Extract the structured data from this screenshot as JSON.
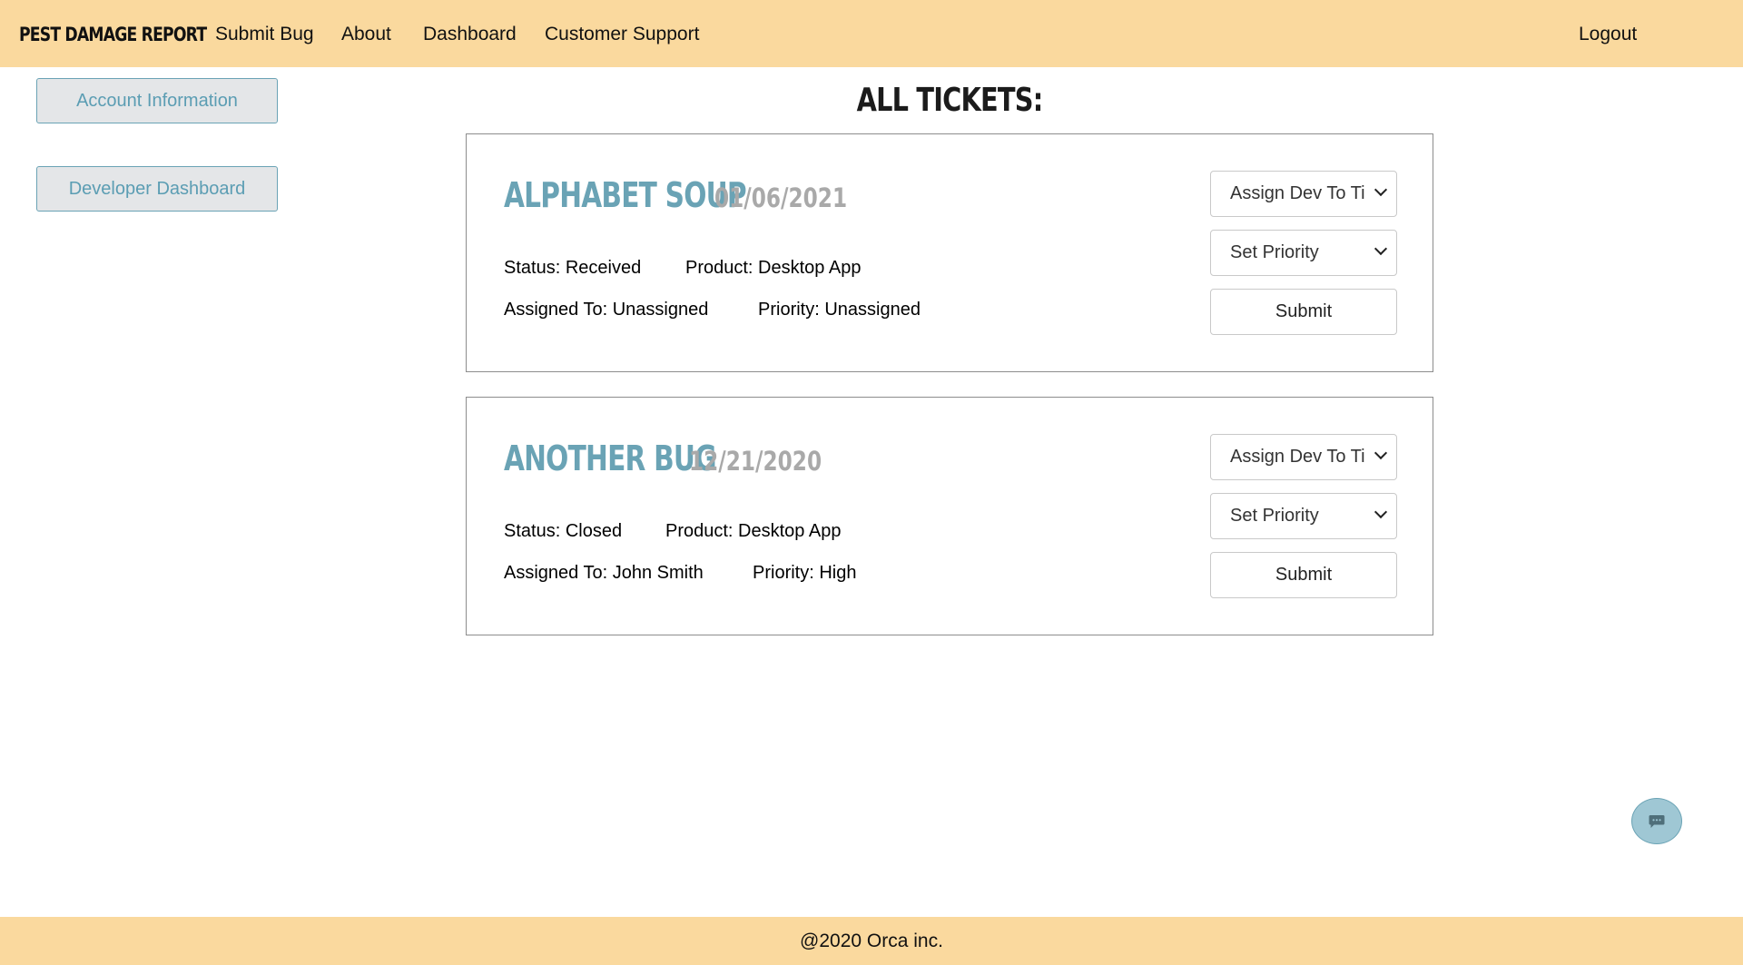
{
  "header": {
    "brand": "PEST DAMAGE REPORT",
    "nav": {
      "submit_bug": "Submit Bug",
      "about": "About",
      "dashboard": "Dashboard",
      "customer_support": "Customer Support",
      "logout": "Logout"
    },
    "background_color": "#fad99e"
  },
  "sidebar": {
    "account_information": "Account Information",
    "developer_dashboard": "Developer Dashboard",
    "accent_color": "#6aa3b5"
  },
  "main": {
    "heading": "ALL TICKETS:",
    "tickets": [
      {
        "title": "ALPHABET SOUP",
        "date": "01/06/2021",
        "status": "Status: Received",
        "product": "Product: Desktop App",
        "assigned_to": "Assigned To: Unassigned",
        "priority": "Priority: Unassigned",
        "assign_select": "Assign Dev To Ticket",
        "priority_select": "Set Priority",
        "submit_label": "Submit"
      },
      {
        "title": "ANOTHER BUG",
        "date": "12/21/2020",
        "status": "Status: Closed",
        "product": "Product: Desktop App",
        "assigned_to": "Assigned To: John Smith",
        "priority": "Priority: High",
        "assign_select": "Assign Dev To Ticket",
        "priority_select": "Set Priority",
        "submit_label": "Submit"
      }
    ]
  },
  "chat": {
    "icon": "chat-bubble-icon",
    "color": "#9fc7d4"
  },
  "footer": {
    "text": "@2020 Orca inc."
  }
}
